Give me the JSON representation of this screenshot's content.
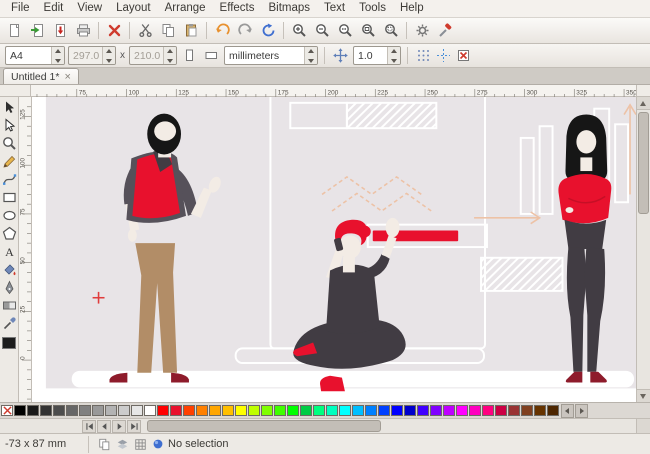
{
  "theme": {
    "ui_bg": "#f1eeea",
    "canvas_bg": "#e8e4e7",
    "figure_red": "#e8112d",
    "figure_dark": "#413c43",
    "figure_dark2": "#56515a",
    "pants_tan": "#b28d67",
    "skin": "#f3ece5",
    "hair_black": "#161616",
    "shoe_dark_red": "#8e1b2b",
    "outline_white": "#ffffff",
    "accent_orange": "#edc2a6"
  },
  "menu": {
    "items": [
      "File",
      "Edit",
      "View",
      "Layout",
      "Arrange",
      "Effects",
      "Bitmaps",
      "Text",
      "Tools",
      "Help"
    ]
  },
  "toolbar_main": {
    "buttons": [
      {
        "name": "new-document"
      },
      {
        "name": "open-document"
      },
      {
        "name": "save-document"
      },
      {
        "name": "print"
      },
      {
        "name": "close-document",
        "sep_before": true
      },
      {
        "name": "cut",
        "sep_before": true
      },
      {
        "name": "copy"
      },
      {
        "name": "paste"
      },
      {
        "name": "undo",
        "sep_before": true
      },
      {
        "name": "redo"
      },
      {
        "name": "refresh"
      },
      {
        "name": "zoom-in",
        "sep_before": true
      },
      {
        "name": "zoom-out"
      },
      {
        "name": "zoom-100"
      },
      {
        "name": "zoom-page"
      },
      {
        "name": "zoom-area"
      },
      {
        "name": "preferences",
        "sep_before": true
      },
      {
        "name": "toolbox"
      }
    ]
  },
  "toolbar_props": {
    "page_format": {
      "value": "A4"
    },
    "page_width": {
      "value": "297.0"
    },
    "times_label": "x",
    "page_height": {
      "value": "210.0"
    },
    "orientation_buttons": [
      {
        "name": "portrait"
      },
      {
        "name": "landscape"
      }
    ],
    "units": {
      "value": "millimeters"
    },
    "nudge": {
      "value": "1.0"
    },
    "snap_buttons": [
      {
        "name": "snap-to-grid"
      },
      {
        "name": "snap-to-guides"
      },
      {
        "name": "snap-to-page"
      }
    ]
  },
  "tabs": [
    {
      "label": "Untitled 1*",
      "close_glyph": "×"
    }
  ],
  "rulers": {
    "h_labels": [
      75,
      100,
      125,
      150,
      175,
      200,
      225,
      250,
      275,
      300,
      325,
      350
    ],
    "v_labels": [
      125,
      100,
      75,
      50,
      25,
      0
    ]
  },
  "tools": {
    "items": [
      {
        "name": "selector"
      },
      {
        "name": "shape-editor"
      },
      {
        "name": "zoom-tool"
      },
      {
        "name": "freehand"
      },
      {
        "name": "bezier"
      },
      {
        "name": "rectangle"
      },
      {
        "name": "ellipse"
      },
      {
        "name": "polygon"
      },
      {
        "name": "text"
      },
      {
        "name": "fill"
      },
      {
        "name": "stroke"
      },
      {
        "name": "gradient"
      },
      {
        "name": "eyedropper"
      }
    ]
  },
  "palette": {
    "colors": [
      "#000000",
      "#1a1a1a",
      "#333333",
      "#4d4d4d",
      "#666666",
      "#808080",
      "#999999",
      "#b3b3b3",
      "#cccccc",
      "#e6e6e6",
      "#ffffff",
      "#ff0000",
      "#e8112d",
      "#ff4000",
      "#ff8000",
      "#ffa600",
      "#ffbf00",
      "#ffff00",
      "#bfff00",
      "#80ff00",
      "#40ff00",
      "#00ff00",
      "#00cc44",
      "#00ff80",
      "#00ffbf",
      "#00ffff",
      "#00bfff",
      "#0080ff",
      "#0040ff",
      "#0000ff",
      "#0000cc",
      "#4000ff",
      "#8000ff",
      "#bf00ff",
      "#ff00ff",
      "#ff00bf",
      "#ff0080",
      "#cc0044",
      "#993333",
      "#804020",
      "#663300",
      "#4d2600"
    ]
  },
  "pagebar": {
    "buttons": [
      {
        "name": "first-page"
      },
      {
        "name": "prev-page"
      },
      {
        "name": "next-page"
      },
      {
        "name": "last-page"
      }
    ]
  },
  "statusbar": {
    "coords": "-73 x 87 mm",
    "icons": [
      {
        "name": "pages"
      },
      {
        "name": "layers"
      },
      {
        "name": "grid"
      }
    ],
    "selection": "No selection"
  }
}
